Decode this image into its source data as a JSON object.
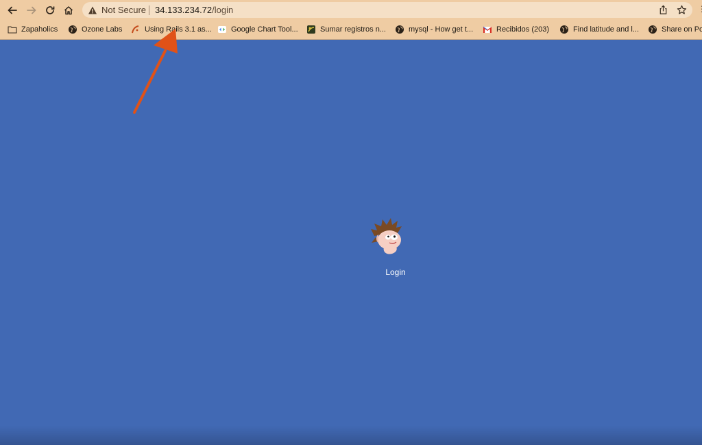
{
  "browser": {
    "security_label": "Not Secure",
    "url_host": "34.133.234.72",
    "url_path": "/login"
  },
  "bookmarks": [
    {
      "label": "Zapaholics",
      "icon": "folder-icon"
    },
    {
      "label": "Ozone Labs",
      "icon": "globe-icon"
    },
    {
      "label": "Using Rails 3.1 as...",
      "icon": "rails-icon"
    },
    {
      "label": "Google Chart Tool...",
      "icon": "google-chart-icon"
    },
    {
      "label": "Sumar registros n...",
      "icon": "site-icon"
    },
    {
      "label": "mysql - How get t...",
      "icon": "globe-icon"
    },
    {
      "label": "Recibidos (203)",
      "icon": "gmail-icon"
    },
    {
      "label": "Find latitude and l...",
      "icon": "globe-icon"
    },
    {
      "label": "Share on Po",
      "icon": "globe-icon"
    }
  ],
  "page": {
    "login_label": "Login"
  },
  "colors": {
    "page_background": "#4169b4",
    "toolbar_background": "#efcca3",
    "annotation_arrow": "#e05218"
  }
}
